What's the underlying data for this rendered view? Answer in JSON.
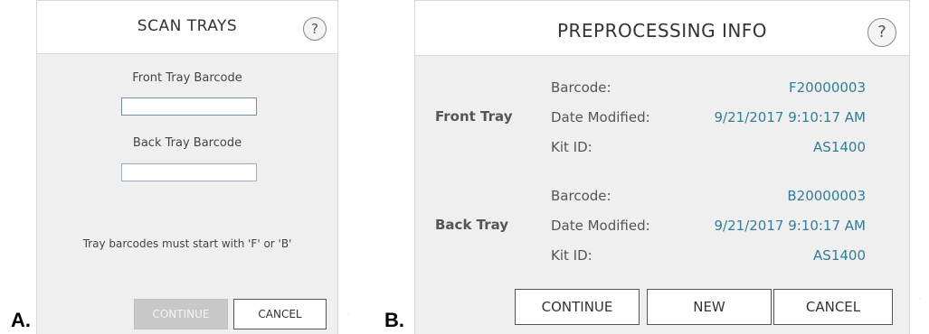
{
  "panel_a": {
    "letter": "A.",
    "title": "SCAN TRAYS",
    "help": "?",
    "front_label": "Front Tray Barcode",
    "front_value": "",
    "back_label": "Back Tray Barcode",
    "back_value": "",
    "hint": "Tray barcodes must start with 'F' or 'B'",
    "continue": "CONTINUE",
    "cancel": "CANCEL"
  },
  "panel_b": {
    "letter": "B.",
    "title": "PREPROCESSING INFO",
    "help": "?",
    "front": {
      "name": "Front Tray",
      "barcode_label": "Barcode:",
      "barcode": "F20000003",
      "date_label": "Date Modified:",
      "date": "9/21/2017 9:10:17 AM",
      "kit_label": "Kit ID:",
      "kit": "AS1400"
    },
    "back": {
      "name": "Back Tray",
      "barcode_label": "Barcode:",
      "barcode": "B20000003",
      "date_label": "Date Modified:",
      "date": "9/21/2017 9:10:17 AM",
      "kit_label": "Kit ID:",
      "kit": "AS1400"
    },
    "continue": "CONTINUE",
    "new": "NEW",
    "cancel": "CANCEL"
  },
  "colors": {
    "value_text": "#2f7f9b",
    "panel_bg": "#efefef",
    "disabled_button": "#c8c8c8"
  }
}
